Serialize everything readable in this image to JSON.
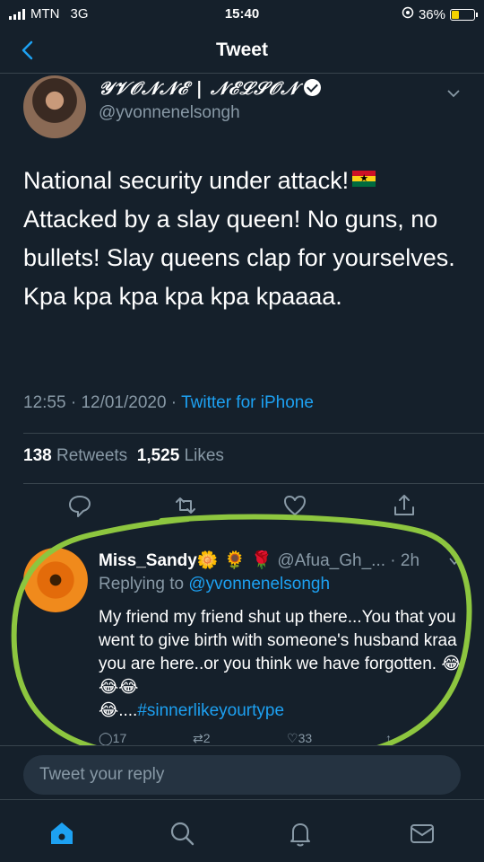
{
  "status_bar": {
    "carrier": "MTN",
    "network": "3G",
    "time": "15:40",
    "battery_percent": "36%",
    "battery_level": 0.36
  },
  "nav": {
    "title": "Tweet"
  },
  "tweet": {
    "display_name": "𝒴𝒱𝒪𝒩𝒩ℰ | 𝒩ℰℒ𝒮𝒪𝒩",
    "handle": "@yvonnenelsongh",
    "text": "National security under attack!",
    "text_rest": "Attacked by a slay queen! No guns, no bullets! Slay queens clap for yourselves. Kpa kpa kpa kpa kpa kpaaaa.",
    "time": "12:55",
    "date": "12/01/2020",
    "source": "Twitter for iPhone",
    "retweets_count": "138",
    "retweets_label": "Retweets",
    "likes_count": "1,525",
    "likes_label": "Likes"
  },
  "reply": {
    "name": "Miss_Sandy",
    "name_emojis": "🌼 🌻 🌹",
    "handle": "@Afua_Gh_...",
    "time": "· 2h",
    "replying_prefix": "Replying to",
    "replying_handle": "@yvonnenelsongh",
    "text": "My friend my friend shut up there...You that you went to give birth with someone's husband kraa you are here..or you think we have forgotten. 😂😂😂",
    "text_tail": "😂....",
    "hashtag": "#sinnerlikeyourtype",
    "reply_count": "17",
    "retweet_count": "2",
    "like_count": "33"
  },
  "composer": {
    "placeholder": "Tweet your reply"
  },
  "tabs": [
    "home-icon",
    "search-icon",
    "notifications-icon",
    "messages-icon"
  ],
  "colors": {
    "background": "#15202b",
    "accent": "#1da1f2",
    "muted": "#8899a6",
    "highlight_circle": "#8dc63f"
  }
}
